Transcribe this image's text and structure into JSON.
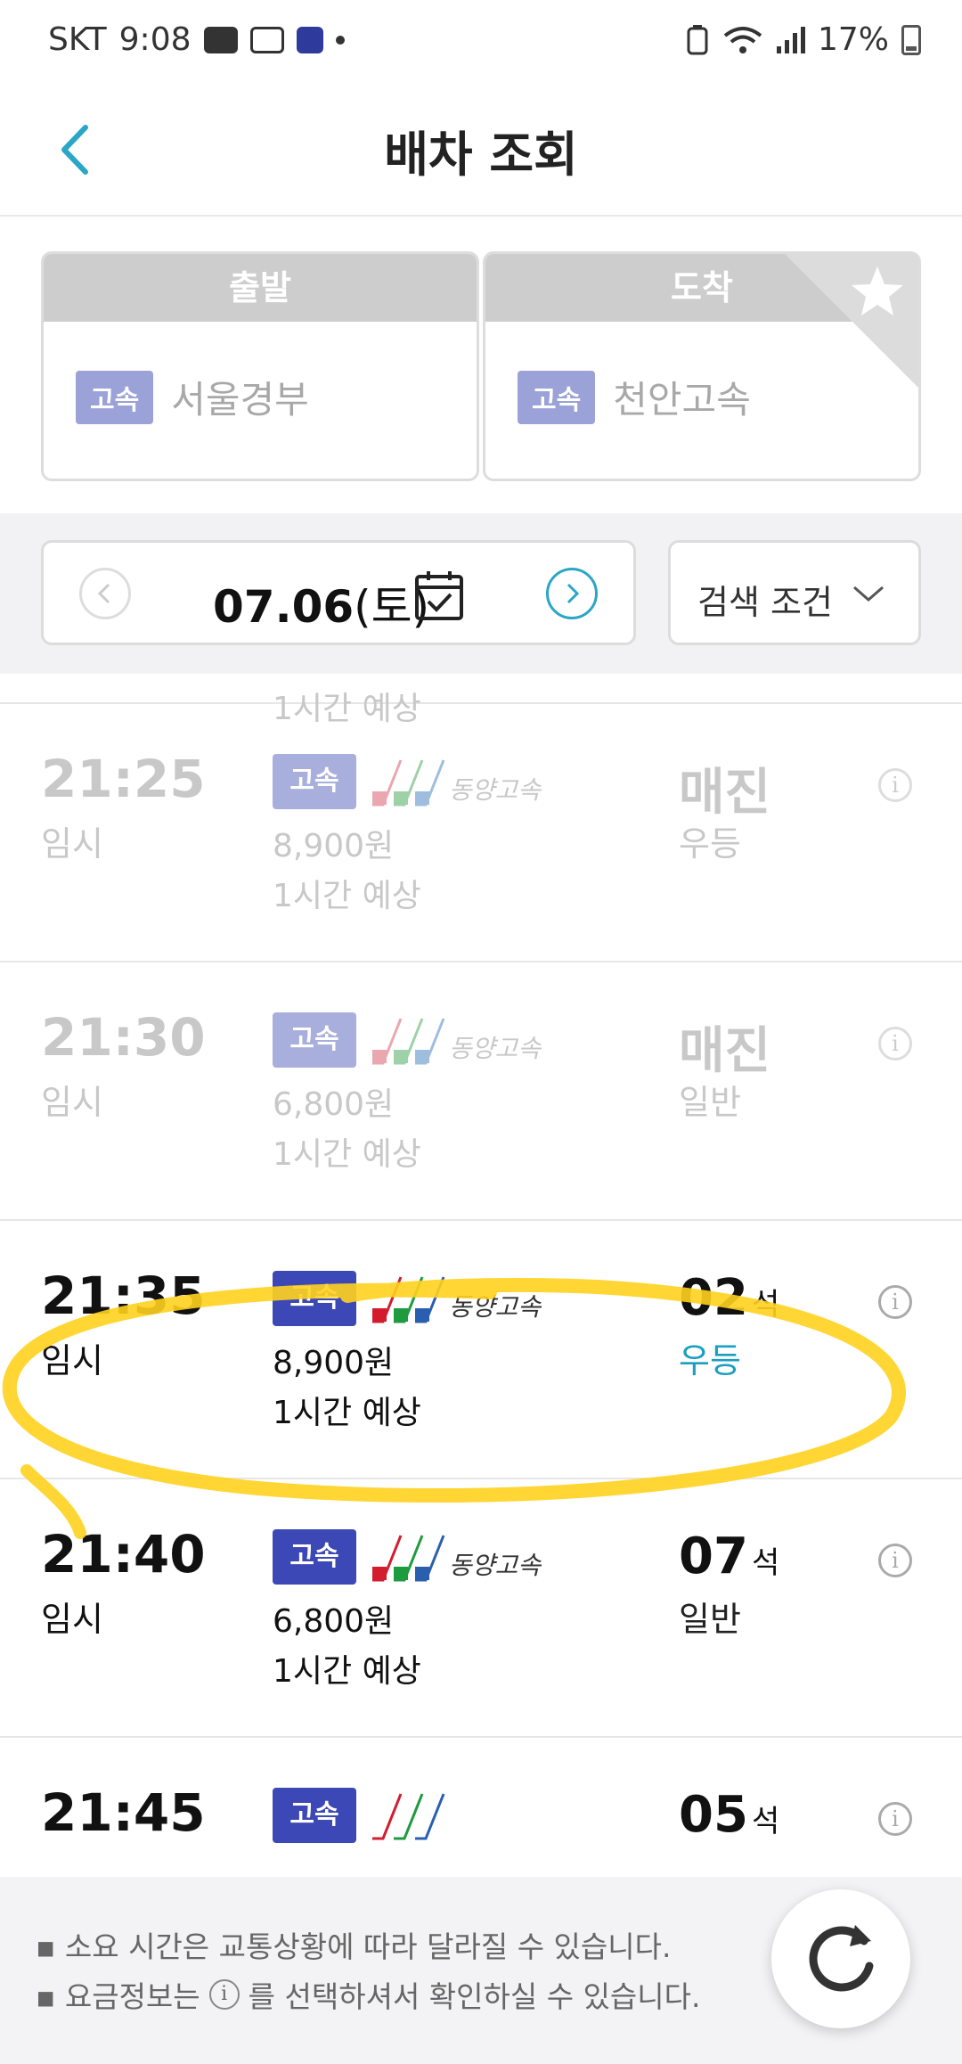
{
  "status": {
    "carrier": "SKT",
    "time": "9:08",
    "battery": "17%"
  },
  "header": {
    "title": "배차 조회"
  },
  "route": {
    "departure_label": "출발",
    "arrival_label": "도착",
    "badge": "고속",
    "departure": "서울경부",
    "arrival": "천안고속"
  },
  "date": {
    "day": "07.06",
    "weekday": "(토)"
  },
  "filter": {
    "label": "검색 조건"
  },
  "list": {
    "partial_top_duration": "1시간 예상",
    "rows": [
      {
        "time": "21:25",
        "type": "임시",
        "badge": "고속",
        "company": "동양고속",
        "price": "8,900원",
        "duration": "1시간 예상",
        "seats": "매진",
        "seat_unit": "",
        "grade": "우등",
        "state": "soldout"
      },
      {
        "time": "21:30",
        "type": "임시",
        "badge": "고속",
        "company": "동양고속",
        "price": "6,800원",
        "duration": "1시간 예상",
        "seats": "매진",
        "seat_unit": "",
        "grade": "일반",
        "state": "soldout"
      },
      {
        "time": "21:35",
        "type": "임시",
        "badge": "고속",
        "company": "동양고속",
        "price": "8,900원",
        "duration": "1시간 예상",
        "seats": "02",
        "seat_unit": "석",
        "grade": "우등",
        "state": "available"
      },
      {
        "time": "21:40",
        "type": "임시",
        "badge": "고속",
        "company": "동양고속",
        "price": "6,800원",
        "duration": "1시간 예상",
        "seats": "07",
        "seat_unit": "석",
        "grade": "일반",
        "state": "available"
      },
      {
        "time": "21:45",
        "type": "",
        "badge": "고속",
        "company": "",
        "price": "",
        "duration": "",
        "seats": "05",
        "seat_unit": "석",
        "grade": "",
        "state": "available"
      }
    ]
  },
  "footer": {
    "note1": "▪ 소요 시간은 교통상황에 따라 달라질 수 있습니다.",
    "note2_before": "▪ 요금정보는",
    "note2_after": "를 선택하셔서 확인하실 수 있습니다."
  },
  "colors": {
    "accent": "#1a9fc0",
    "badge_active": "#3c48b5",
    "badge_inactive": "#a9afdd",
    "highlight": "#ffd21e"
  }
}
